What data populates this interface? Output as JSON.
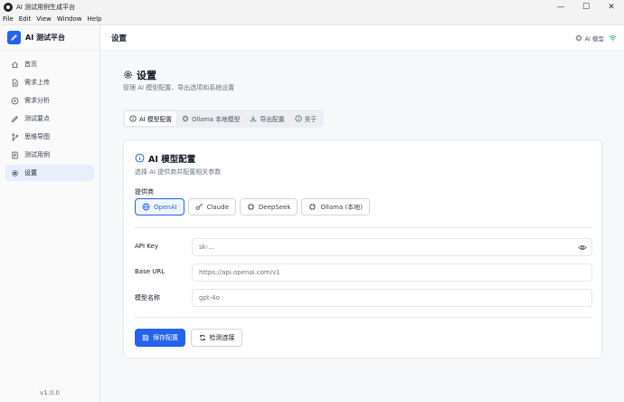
{
  "window": {
    "title": "AI 测试用例生成平台",
    "controls": [
      "—",
      "☐",
      "✕"
    ]
  },
  "menu": [
    "File",
    "Edit",
    "View",
    "Window",
    "Help"
  ],
  "sidebar": {
    "brand": "AI 测试平台",
    "items": [
      {
        "label": "首页",
        "icon": "home-icon"
      },
      {
        "label": "需求上传",
        "icon": "file-icon"
      },
      {
        "label": "需求分析",
        "icon": "analysis-icon"
      },
      {
        "label": "测试要点",
        "icon": "pen-icon"
      },
      {
        "label": "思维导图",
        "icon": "branch-icon"
      },
      {
        "label": "测试用例",
        "icon": "document-icon"
      },
      {
        "label": "设置",
        "icon": "gear-icon",
        "active": true
      }
    ],
    "version": "v1.0.0"
  },
  "header": {
    "title": "设置",
    "status_label": "AI 模型"
  },
  "page": {
    "title": "设置",
    "subtitle": "管理 AI 模型配置、导出选项和系统设置"
  },
  "tabs": [
    {
      "label": "AI 模型配置",
      "icon": "info-icon",
      "active": true
    },
    {
      "label": "Ollama 本地模型",
      "icon": "chip-icon"
    },
    {
      "label": "导出配置",
      "icon": "download-icon"
    },
    {
      "label": "关于",
      "icon": "info-icon"
    }
  ],
  "card": {
    "title": "AI 模型配置",
    "subtitle": "选择 AI 提供商并配置相关参数",
    "provider_label": "提供商",
    "providers": [
      {
        "label": "OpenAI",
        "icon": "globe-icon",
        "active": true
      },
      {
        "label": "Claude",
        "icon": "key-icon"
      },
      {
        "label": "DeepSeek",
        "icon": "chip-icon"
      },
      {
        "label": "Ollama (本地)",
        "icon": "chip-icon"
      }
    ],
    "fields": {
      "api_key": {
        "label": "API Key",
        "value": "sk-..."
      },
      "base_url": {
        "label": "Base URL",
        "value": "https://api.openai.com/v1"
      },
      "model": {
        "label": "模型名称",
        "value": "gpt-4o"
      }
    },
    "save_label": "保存配置",
    "test_label": "检测连接"
  },
  "colors": {
    "accent": "#2563eb",
    "status_green": "#22c55e"
  }
}
